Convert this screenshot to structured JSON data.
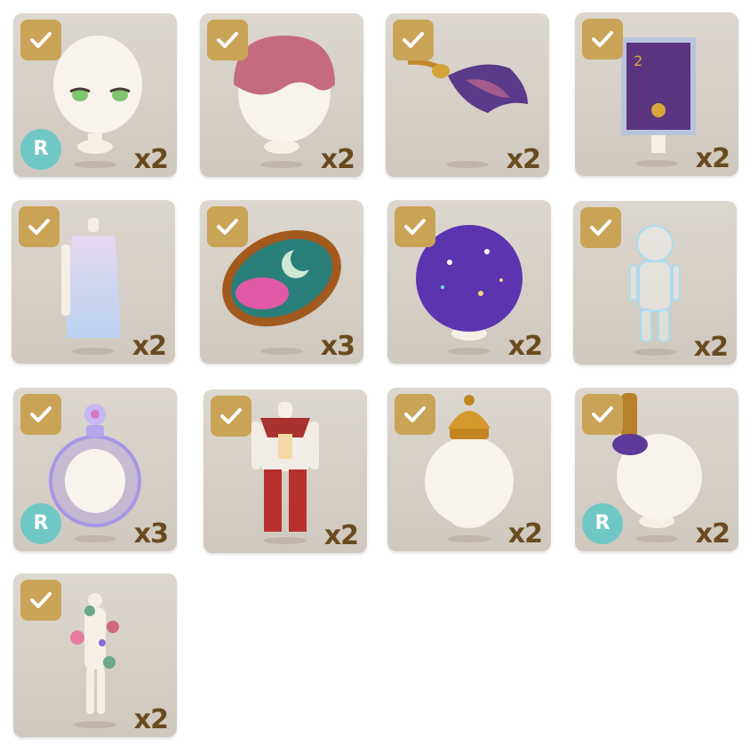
{
  "items": [
    {
      "name": "face-item",
      "count": "x2",
      "rarity": "R"
    },
    {
      "name": "pink-hair-item",
      "count": "x2",
      "rarity": ""
    },
    {
      "name": "feather-hairpin-item",
      "count": "x2",
      "rarity": ""
    },
    {
      "name": "stamp-background-item",
      "count": "x2",
      "rarity": ""
    },
    {
      "name": "gradient-dress-item",
      "count": "x2",
      "rarity": ""
    },
    {
      "name": "moon-mirror-item",
      "count": "x3",
      "rarity": ""
    },
    {
      "name": "galaxy-hair-item",
      "count": "x2",
      "rarity": ""
    },
    {
      "name": "hologram-body-item",
      "count": "x2",
      "rarity": ""
    },
    {
      "name": "bubble-bottle-item",
      "count": "x3",
      "rarity": "R"
    },
    {
      "name": "sailor-outfit-item",
      "count": "x2",
      "rarity": ""
    },
    {
      "name": "crown-hat-item",
      "count": "x2",
      "rarity": ""
    },
    {
      "name": "headphone-accessory-item",
      "count": "x2",
      "rarity": "R"
    },
    {
      "name": "flower-body-item",
      "count": "x2",
      "rarity": ""
    }
  ],
  "colors": {
    "tile_bg": "#d6d0c7",
    "check_bg": "#c9a457",
    "count_text": "#6a4b1f",
    "rarity_badge": "#6fc8c6"
  }
}
